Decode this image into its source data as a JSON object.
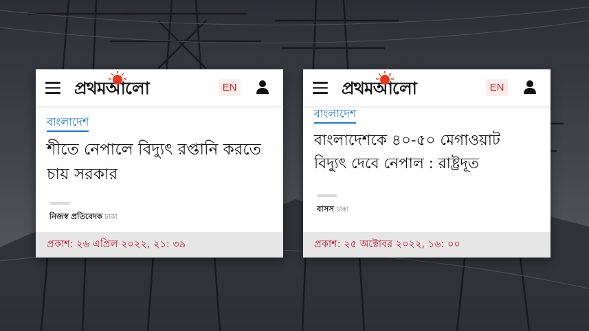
{
  "cards": [
    {
      "logo_text": "প্রথমআলো",
      "lang_label": "EN",
      "category": "বাংলাদেশ",
      "headline_line1": "শীতে নেপালে বিদ্যুৎ রপ্তানি করতে",
      "headline_line2": "চায় সরকার",
      "author": "নিজস্ব প্রতিবেদক",
      "location": "ঢাকা",
      "published": "প্রকাশ: ২৬ এপ্রিল ২০২২, ২১: ৩৯"
    },
    {
      "logo_text": "প্রথমআলো",
      "lang_label": "EN",
      "category": "বাংলাদেশ",
      "headline_line1": "বাংলাদেশকে ৪০-৫০ মেগাওয়াট",
      "headline_line2": "বিদ্যুৎ দেবে নেপাল : রাষ্ট্রদূত",
      "author": "বাসস",
      "location": "ঢাকা",
      "published": "প্রকাশ: ২৫ অক্টোবর ২০২২, ১৬: ০০"
    }
  ],
  "colors": {
    "category_blue": "#1976d2",
    "published_red": "#c1162d",
    "logo_sun": "#e8361f",
    "lang_text": "#d1252a"
  }
}
